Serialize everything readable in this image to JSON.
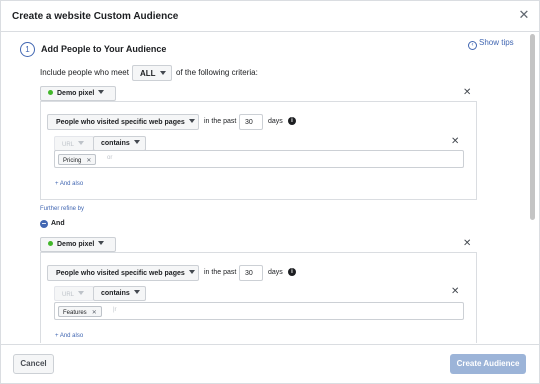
{
  "dialog": {
    "title": "Create a website Custom Audience",
    "close_glyph": "✕"
  },
  "section": {
    "step": "1",
    "title": "Add People to Your Audience",
    "show_tips": "Show tips"
  },
  "include": {
    "prefix": "Include people who meet",
    "match_value": "ALL",
    "suffix": "of the following criteria:"
  },
  "rules": [
    {
      "pixel": "Demo pixel",
      "visit_type": "People who visited specific web pages",
      "in_past_label": "in the past",
      "days_value": "30",
      "days_label": "days",
      "url_label": "URL",
      "operator": "contains",
      "token": "Pricing",
      "value_hint": "or",
      "and_also": "+ And also"
    },
    {
      "pixel": "Demo pixel",
      "visit_type": "People who visited specific web pages",
      "in_past_label": "in the past",
      "days_value": "30",
      "days_label": "days",
      "url_label": "URL",
      "operator": "contains",
      "token": "Features",
      "value_hint": "|r",
      "and_also": "+ And also"
    }
  ],
  "refine": {
    "further_refine": "Further refine by",
    "and_label": "And"
  },
  "footer": {
    "cancel": "Cancel",
    "create": "Create Audience"
  },
  "colors": {
    "accent": "#4267b2",
    "pixel_status": "#42b72a",
    "create_disabled": "#9cb4d8"
  }
}
